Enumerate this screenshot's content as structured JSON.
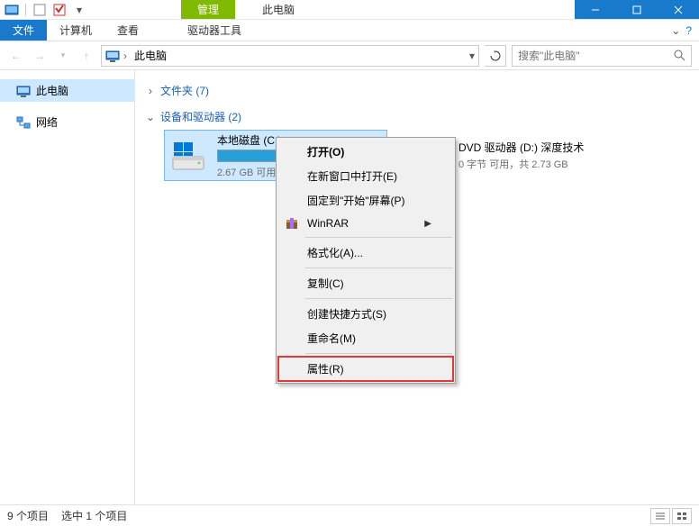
{
  "titlebar": {
    "manage_tab": "管理",
    "app_title": "此电脑"
  },
  "ribbon": {
    "file": "文件",
    "computer": "计算机",
    "view": "查看",
    "drive_tools": "驱动器工具"
  },
  "nav": {
    "breadcrumb": "此电脑",
    "search_placeholder": "搜索\"此电脑\""
  },
  "sidebar": {
    "this_pc": "此电脑",
    "network": "网络"
  },
  "groups": {
    "folders": "文件夹 (7)",
    "devices": "设备和驱动器 (2)"
  },
  "drives": {
    "c": {
      "name": "本地磁盘 (C:)",
      "status": "2.67 GB 可用",
      "fill_percent": 82
    },
    "d": {
      "name": "DVD 驱动器 (D:) 深度技术",
      "status": "0 字节 可用，共 2.73 GB"
    }
  },
  "context_menu": {
    "open": "打开(O)",
    "open_new_window": "在新窗口中打开(E)",
    "pin_to_start": "固定到\"开始\"屏幕(P)",
    "winrar": "WinRAR",
    "format": "格式化(A)...",
    "copy": "复制(C)",
    "create_shortcut": "创建快捷方式(S)",
    "rename": "重命名(M)",
    "properties": "属性(R)"
  },
  "statusbar": {
    "count": "9 个项目",
    "selection": "选中 1 个项目"
  }
}
